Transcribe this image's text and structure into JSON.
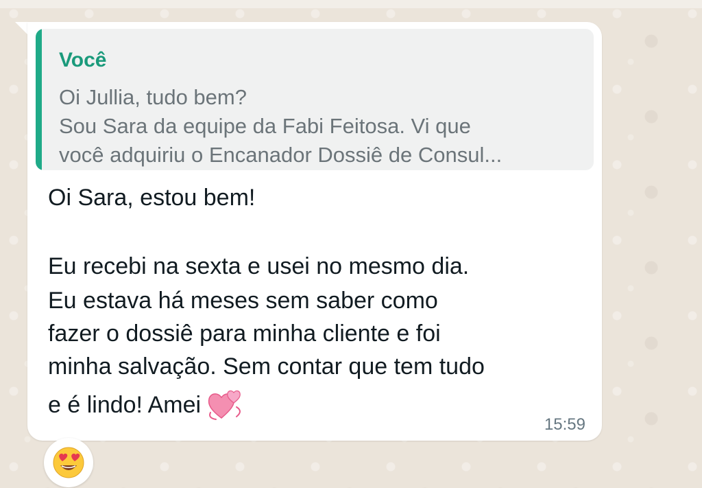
{
  "quoted_message": {
    "author": "Você",
    "lines": [
      "Oi Jullia, tudo bem?",
      "Sou Sara da equipe da Fabi Feitosa.  Vi que",
      "você adquiriu o Encanador Dossiê de Consul..."
    ]
  },
  "message": {
    "lines": [
      "Oi Sara, estou bem!",
      "Eu recebi na sexta e usei no mesmo dia.",
      "Eu estava há meses sem saber como",
      "fazer o dossiê para minha cliente e foi",
      "minha salvação. Sem contar que tem tudo",
      "e é lindo! Amei"
    ],
    "inline_emoji": "revolving-hearts-icon",
    "time": "15:59"
  },
  "reaction": {
    "emoji": "heart-eyes-face-icon"
  },
  "colors": {
    "wallpaper": "#ebe4da",
    "bubble": "#ffffff",
    "quote_bg": "#f0f1f1",
    "quote_bar": "#1faa88",
    "quote_author": "#1a9a7b",
    "quote_text": "#6b7479",
    "message_text": "#111b21",
    "timestamp": "#667781"
  }
}
